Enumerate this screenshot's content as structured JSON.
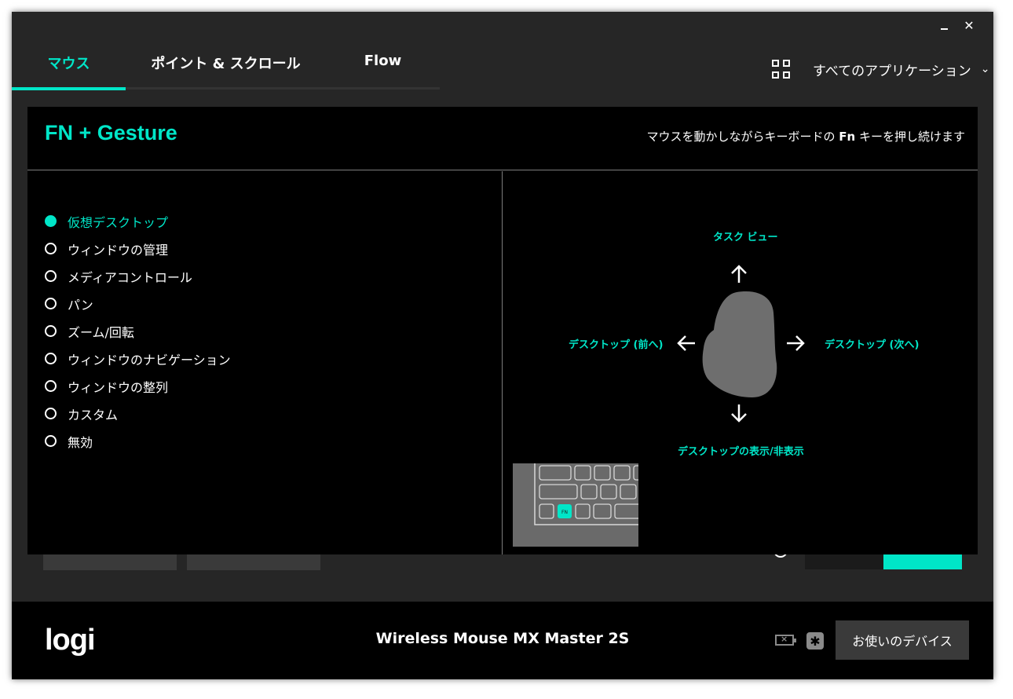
{
  "window": {
    "minimize_icon": "minimize-icon",
    "close_glyph": "✕"
  },
  "tabs": [
    {
      "label": "マウス",
      "active": true
    },
    {
      "label": "ポイント & スクロール",
      "active": false
    },
    {
      "label": "Flow",
      "active": false
    }
  ],
  "app_selector": {
    "label": "すべてのアプリケーション",
    "icon": "grid-icon",
    "chevron": "⌄"
  },
  "panel": {
    "title": "FN + Gesture",
    "hint_before": "マウスを動かしながらキーボードの ",
    "hint_key": "Fn",
    "hint_after": " キーを押し続けます"
  },
  "options": [
    {
      "label": "仮想デスクトップ",
      "selected": true
    },
    {
      "label": "ウィンドウの管理",
      "selected": false
    },
    {
      "label": "メディアコントロール",
      "selected": false
    },
    {
      "label": "パン",
      "selected": false
    },
    {
      "label": "ズーム/回転",
      "selected": false
    },
    {
      "label": "ウィンドウのナビゲーション",
      "selected": false
    },
    {
      "label": "ウィンドウの整列",
      "selected": false
    },
    {
      "label": "カスタム",
      "selected": false
    },
    {
      "label": "無効",
      "selected": false
    }
  ],
  "gesture": {
    "up": "タスク ビュー",
    "left": "デスクトップ (前へ)",
    "right": "デスクトップ (次へ)",
    "down": "デスクトップの表示/非表示",
    "fn_key": "FN"
  },
  "footer": {
    "logo": "logi",
    "device": "Wireless Mouse MX Master 2S",
    "devices_button": "お使いのデバイス",
    "battery_glyph": "×",
    "unifying_glyph": "✱"
  },
  "colors": {
    "accent": "#00e6c8",
    "window_bg": "#262626",
    "panel_bg": "#000000"
  }
}
